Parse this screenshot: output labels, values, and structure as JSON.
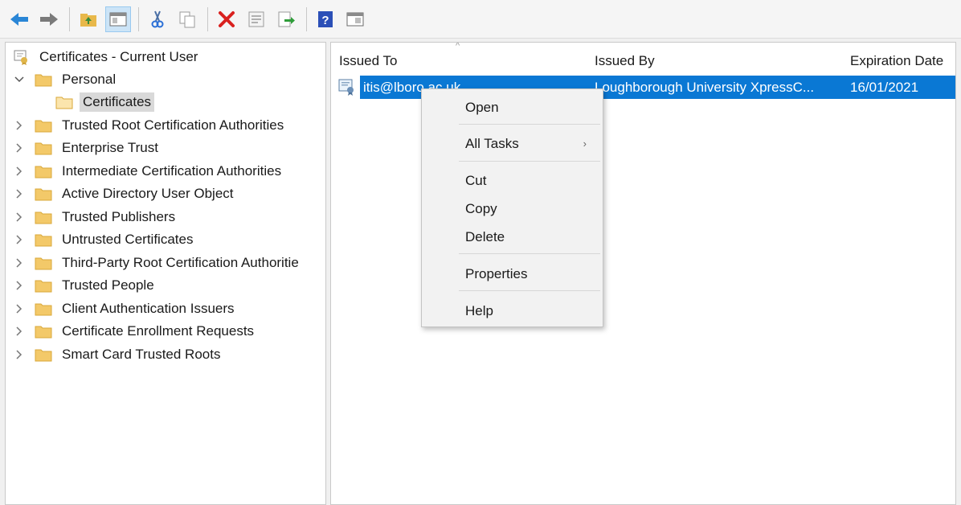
{
  "toolbar": {
    "buttons": [
      "back-arrow-icon",
      "forward-arrow-icon",
      "up-folder-icon",
      "show-hide-tree-icon",
      "cut-icon",
      "copy-icon",
      "delete-icon",
      "properties-icon",
      "export-icon",
      "help-icon",
      "console-icon"
    ]
  },
  "tree": {
    "root_label": "Certificates - Current User",
    "items": [
      {
        "label": "Personal",
        "expanded": true
      },
      {
        "label": "Certificates",
        "selected": true
      },
      {
        "label": "Trusted Root Certification Authorities"
      },
      {
        "label": "Enterprise Trust"
      },
      {
        "label": "Intermediate Certification Authorities"
      },
      {
        "label": "Active Directory User Object"
      },
      {
        "label": "Trusted Publishers"
      },
      {
        "label": "Untrusted Certificates"
      },
      {
        "label": "Third-Party Root Certification Authoritie"
      },
      {
        "label": "Trusted People"
      },
      {
        "label": "Client Authentication Issuers"
      },
      {
        "label": "Certificate Enrollment Requests"
      },
      {
        "label": "Smart Card Trusted Roots"
      }
    ]
  },
  "list": {
    "columns": [
      "Issued To",
      "Issued By",
      "Expiration Date"
    ],
    "rows": [
      {
        "issued_to": "itis@lboro.ac.uk",
        "issued_by": "Loughborough University XpressC...",
        "expiration": "16/01/2021"
      }
    ]
  },
  "context_menu": {
    "items": [
      "Open",
      "All Tasks",
      "Cut",
      "Copy",
      "Delete",
      "Properties",
      "Help"
    ]
  },
  "colors": {
    "selection": "#0a78d4",
    "folder": "#f3c969",
    "pane_bg": "#ffffff",
    "chrome_bg": "#f0f0f0"
  }
}
